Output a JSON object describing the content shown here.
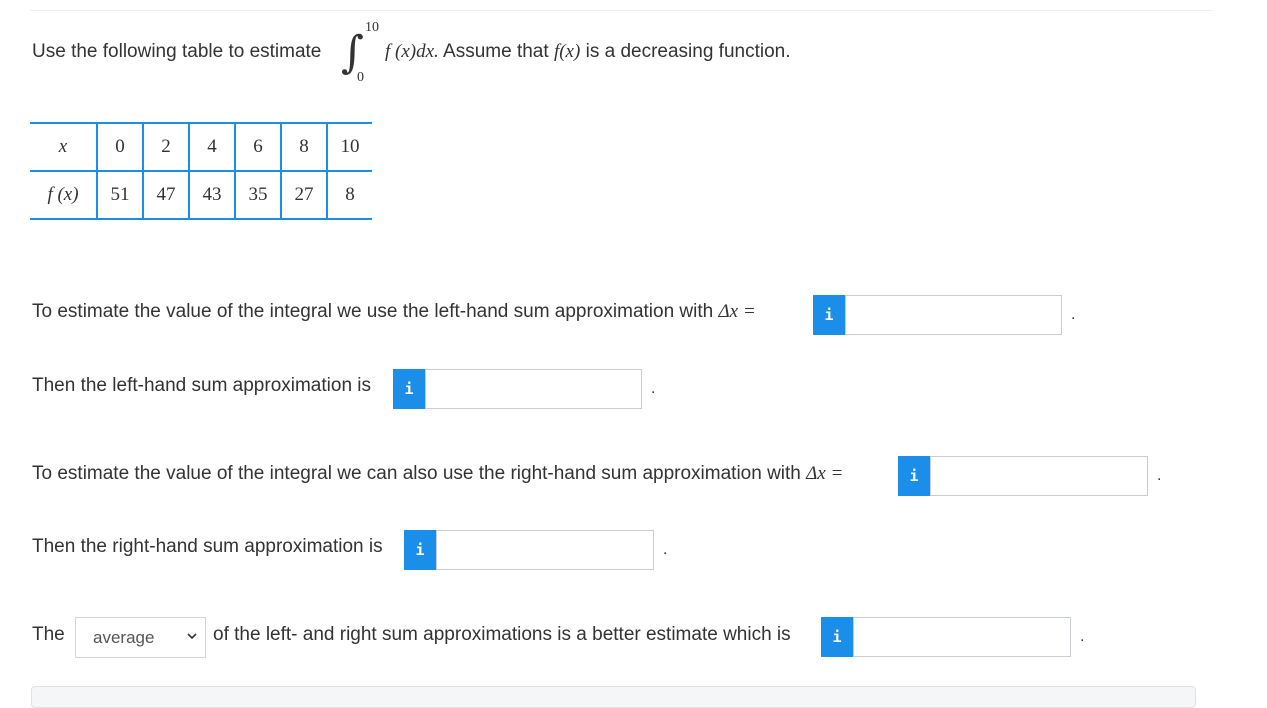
{
  "question": {
    "intro": "Use the following table to estimate",
    "integral_upper": "10",
    "integral_lower": "0",
    "integrand": "f (x)dx.",
    "assumption_prefix": "Assume that",
    "assumption_func": "f(x)",
    "assumption_suffix": "is a decreasing function."
  },
  "table": {
    "x_label": "x",
    "fx_label": "f (x)",
    "x_values": [
      "0",
      "2",
      "4",
      "6",
      "8",
      "10"
    ],
    "fx_values": [
      "51",
      "47",
      "43",
      "35",
      "27",
      "8"
    ]
  },
  "lines": {
    "left_dx_text": "To estimate the value of the integral we use the left-hand sum approximation with",
    "delta_x": "Δx =",
    "left_sum_text": "Then the left-hand sum approximation is",
    "right_dx_text": "To estimate the value of the integral we can also use the right-hand sum approximation with",
    "right_sum_text": "Then the right-hand sum approximation is",
    "the": "The",
    "avg_text": "of the left- and right sum approximations is a better estimate which is",
    "period": "."
  },
  "select": {
    "selected": "average"
  },
  "info_button": {
    "label": "i"
  },
  "colors": {
    "accent": "#1a8ee8"
  }
}
